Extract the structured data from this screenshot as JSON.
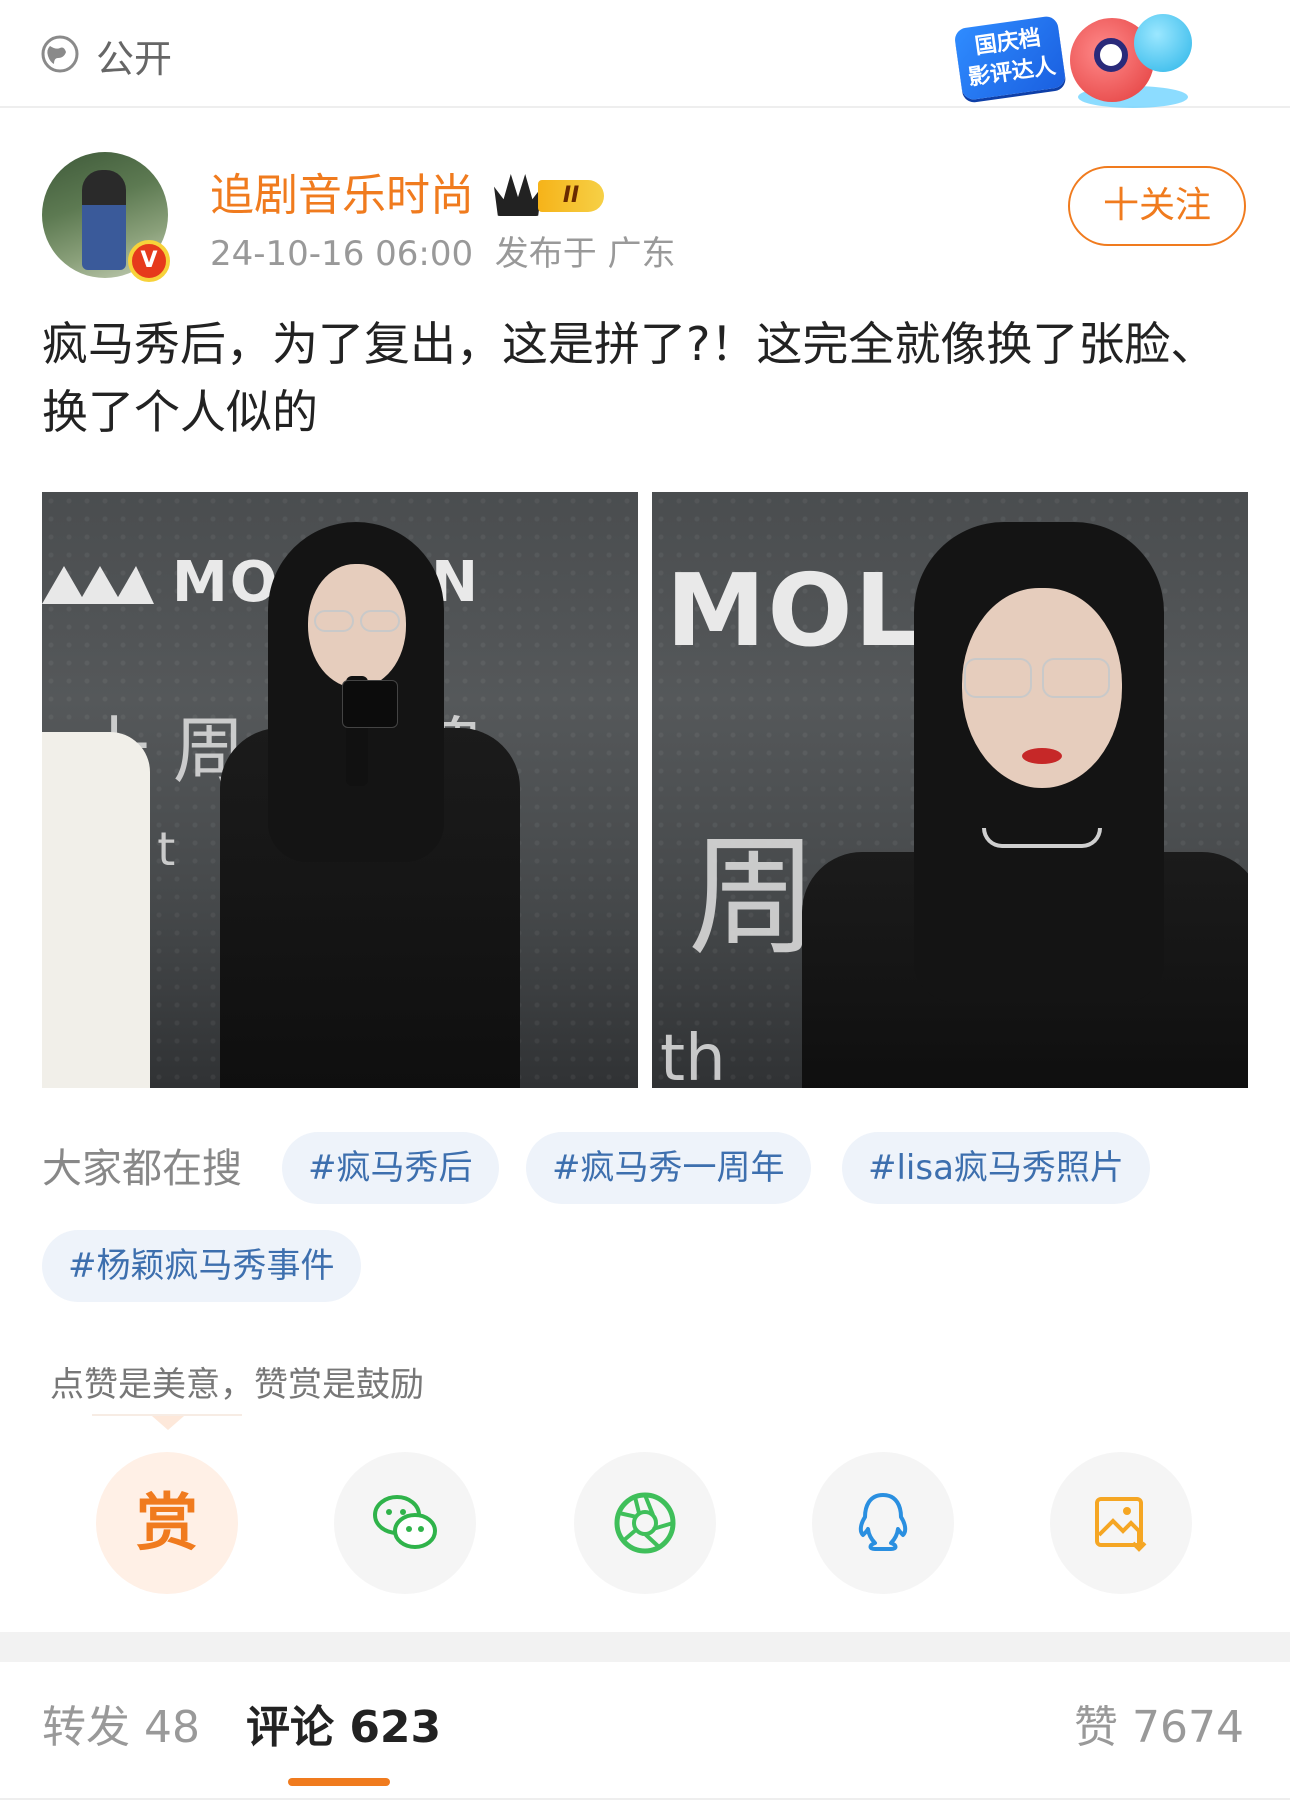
{
  "header": {
    "visibility_label": "公开",
    "event_badge_text": "国庆档\n影评达人"
  },
  "author": {
    "name": "追剧音乐时尚",
    "verified_badge": "V",
    "level_badge": "II",
    "timestamp": "24-10-16 06:00",
    "location": "发布于 广东",
    "follow_label": "十关注"
  },
  "post": {
    "text": "疯马秀后，为了复出，这是拼了?！这完全就像换了张脸、换了个人似的",
    "photos": [
      {
        "wall_logo": "MOL   ON",
        "wall_cjk": "十 周   品 牌",
        "wall_small": "0t          ERS"
      },
      {
        "wall_logo": "MOLS",
        "wall_cjk": "周",
        "wall_small": "th"
      }
    ]
  },
  "hot_search": {
    "label": "大家都在搜",
    "tags": [
      "#疯马秀后",
      "#疯马秀一周年",
      "#lisa疯马秀照片",
      "#杨颖疯马秀事件"
    ]
  },
  "reward": {
    "hint": "点赞是美意，赞赏是鼓励",
    "reward_char": "赏"
  },
  "share": {
    "icons": [
      "wechat-icon",
      "moments-icon",
      "qq-icon",
      "save-image-icon"
    ],
    "colors": {
      "wechat": "#2fb34a",
      "moments": "#3fbf5a",
      "qq": "#2a8fe0",
      "save": "#f5a623"
    }
  },
  "stats": {
    "repost": "转发 48",
    "comment": "评论 623",
    "like": "赞 7674"
  },
  "colors": {
    "accent": "#f07b1e",
    "tag_bg": "#eef3fa",
    "tag_text": "#3d6fae"
  }
}
